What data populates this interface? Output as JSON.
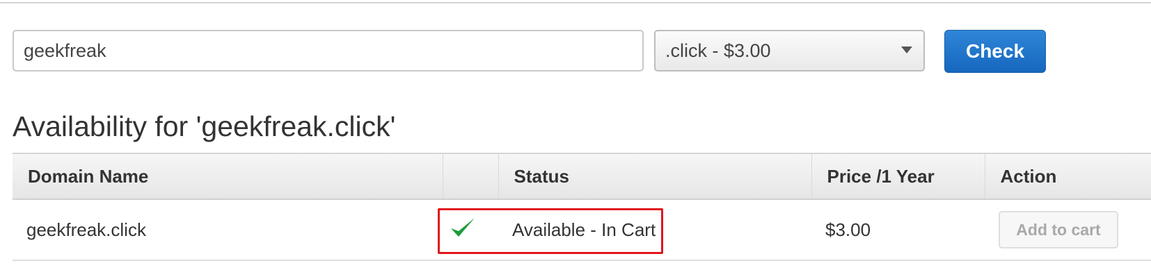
{
  "search": {
    "domain_value": "geekfreak",
    "tld_selected": ".click - $3.00",
    "check_label": "Check"
  },
  "results": {
    "heading": "Availability for 'geekfreak.click'",
    "columns": [
      "Domain Name",
      "",
      "Status",
      "Price /1 Year",
      "Action"
    ],
    "rows": [
      {
        "domain": "geekfreak.click",
        "status": "Available - In Cart",
        "price": "$3.00",
        "action_label": "Add to cart"
      }
    ]
  },
  "colors": {
    "primary_button": "#1e74c8",
    "status_ok": "#1e9b3a",
    "highlight": "#e0161c"
  },
  "icons": {
    "status": "checkmark-icon",
    "select": "caret-down-icon"
  }
}
